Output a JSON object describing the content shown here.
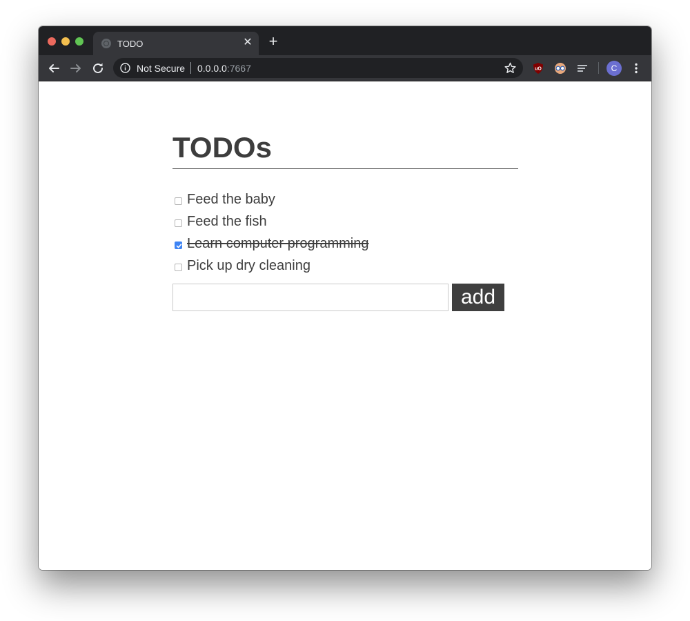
{
  "browser": {
    "tab": {
      "title": "TODO",
      "close_glyph": "✕",
      "favicon": "globe-icon"
    },
    "new_tab_glyph": "+",
    "toolbar": {
      "back_icon": "arrow-left-icon",
      "forward_icon": "arrow-right-icon",
      "reload_icon": "reload-icon",
      "security_label": "Not Secure",
      "url_host": "0.0.0.0",
      "url_port": ":7667",
      "bookmark_icon": "star-icon",
      "extensions": [
        "ublock-origin-icon",
        "glasses-extension-icon",
        "reader-lines-icon"
      ],
      "profile_initial": "C",
      "profile_color": "#6b6fd1",
      "menu_icon": "kebab-menu-icon"
    }
  },
  "page": {
    "heading": "TODOs",
    "todos": [
      {
        "text": "Feed the baby",
        "done": false
      },
      {
        "text": "Feed the fish",
        "done": false
      },
      {
        "text": "Learn computer programming",
        "done": true
      },
      {
        "text": "Pick up dry cleaning",
        "done": false
      }
    ],
    "new_todo_value": "",
    "new_todo_placeholder": "",
    "add_button_label": "add"
  },
  "colors": {
    "titlebar": "#202124",
    "toolbar": "#35363a",
    "checkbox_checked": "#3e84f4",
    "add_button": "#3f3f3f",
    "text": "#3d3d3d"
  }
}
